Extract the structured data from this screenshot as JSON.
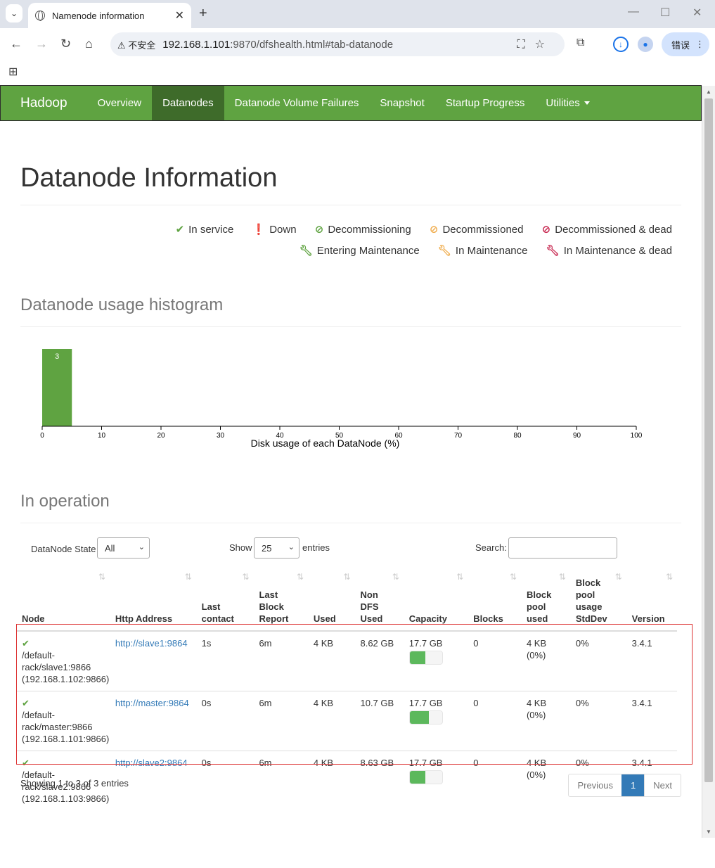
{
  "browser": {
    "tab_title": "Namenode information",
    "url_host": "192.168.1.101",
    "url_rest": ":9870/dfshealth.html#tab-datanode",
    "security_label": "不安全",
    "error_button": "错误"
  },
  "nav": {
    "brand": "Hadoop",
    "items": [
      {
        "label": "Overview"
      },
      {
        "label": "Datanodes"
      },
      {
        "label": "Datanode Volume Failures"
      },
      {
        "label": "Snapshot"
      },
      {
        "label": "Startup Progress"
      },
      {
        "label": "Utilities"
      }
    ]
  },
  "page": {
    "title": "Datanode Information",
    "legend": [
      {
        "label": "In service",
        "color": "#5fa341",
        "icon": "check-icon"
      },
      {
        "label": "Down",
        "color": "#c7254e",
        "icon": "exclamation-icon"
      },
      {
        "label": "Decommissioning",
        "color": "#5fa341",
        "icon": "ban-icon"
      },
      {
        "label": "Decommissioned",
        "color": "#f0ad4e",
        "icon": "ban-icon"
      },
      {
        "label": "Decommissioned & dead",
        "color": "#c7254e",
        "icon": "ban-icon"
      },
      {
        "label": "Entering Maintenance",
        "color": "#5fa341",
        "icon": "wrench-icon"
      },
      {
        "label": "In Maintenance",
        "color": "#f0ad4e",
        "icon": "wrench-icon"
      },
      {
        "label": "In Maintenance & dead",
        "color": "#c7254e",
        "icon": "wrench-icon"
      }
    ],
    "histogram_heading": "Datanode usage histogram",
    "operation_heading": "In operation"
  },
  "chart_data": {
    "type": "bar",
    "title": "",
    "xlabel": "Disk usage of each DataNode (%)",
    "ylabel": "",
    "xlim": [
      0,
      100
    ],
    "xticks": [
      "0",
      "10",
      "20",
      "30",
      "40",
      "50",
      "60",
      "70",
      "80",
      "90",
      "100"
    ],
    "bins": [
      {
        "x0": 0,
        "x1": 5,
        "count": 3
      }
    ],
    "color": "#5fa341"
  },
  "controls": {
    "state_label": "DataNode State",
    "state_value": "All",
    "show_label": "Show",
    "show_value": "25",
    "entries_label": "entries",
    "search_label": "Search:"
  },
  "table": {
    "headers": [
      "Node",
      "Http Address",
      "Last contact",
      "Last Block Report",
      "Used",
      "Non DFS Used",
      "Capacity",
      "Blocks",
      "Block pool used",
      "Block pool usage StdDev",
      "Version"
    ],
    "rows": [
      {
        "node": "/default-rack/slave1:9866 (192.168.1.102:9866)",
        "http": "http://slave1:9864",
        "last_contact": "1s",
        "last_block": "6m",
        "used": "4 KB",
        "non_dfs": "8.62 GB",
        "capacity": "17.7 GB",
        "capacity_used_pct": 49,
        "blocks": "0",
        "bp_used": "4 KB (0%)",
        "stddev": "0%",
        "version": "3.4.1"
      },
      {
        "node": "/default-rack/master:9866 (192.168.1.101:9866)",
        "http": "http://master:9864",
        "last_contact": "0s",
        "last_block": "6m",
        "used": "4 KB",
        "non_dfs": "10.7 GB",
        "capacity": "17.7 GB",
        "capacity_used_pct": 60,
        "blocks": "0",
        "bp_used": "4 KB (0%)",
        "stddev": "0%",
        "version": "3.4.1"
      },
      {
        "node": "/default-rack/slave2:9866 (192.168.1.103:9866)",
        "http": "http://slave2:9864",
        "last_contact": "0s",
        "last_block": "6m",
        "used": "4 KB",
        "non_dfs": "8.63 GB",
        "capacity": "17.7 GB",
        "capacity_used_pct": 49,
        "blocks": "0",
        "bp_used": "4 KB (0%)",
        "stddev": "0%",
        "version": "3.4.1"
      }
    ]
  },
  "footer": {
    "showing": "Showing 1 to 3 of 3 entries",
    "prev": "Previous",
    "page": "1",
    "next": "Next"
  }
}
